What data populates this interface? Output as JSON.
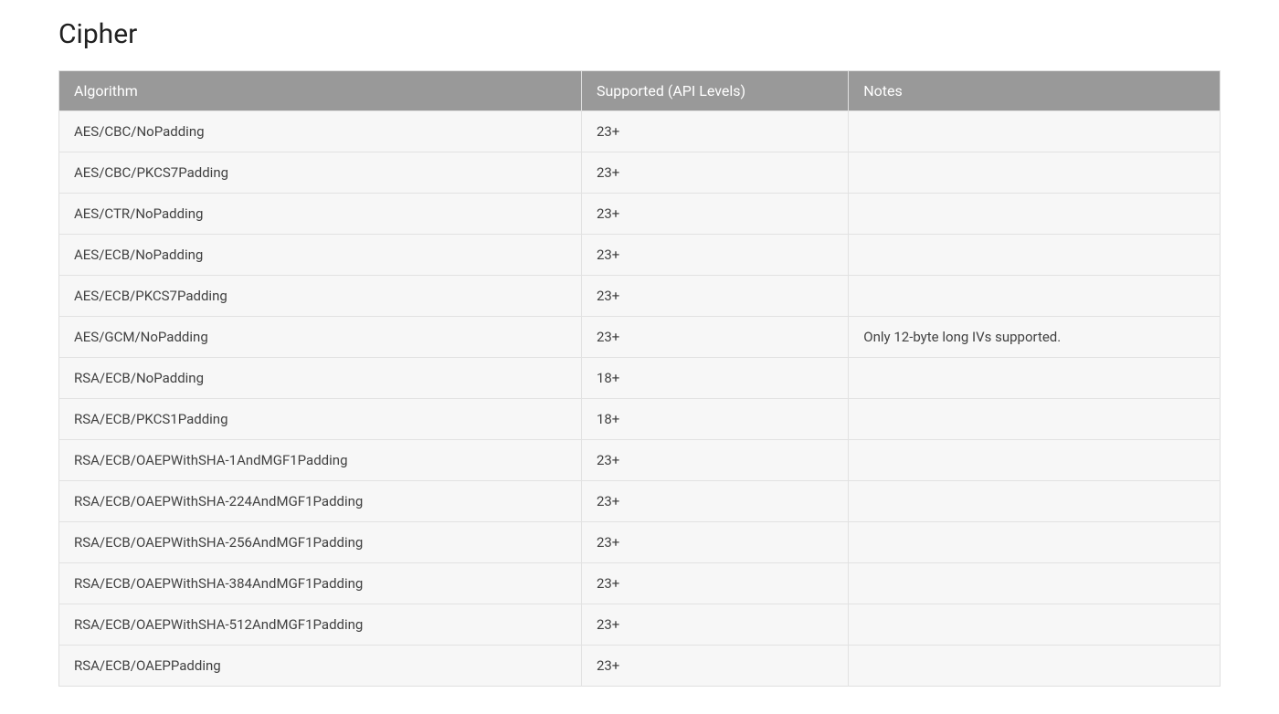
{
  "section": {
    "title": "Cipher"
  },
  "table": {
    "headers": {
      "algorithm": "Algorithm",
      "supported": "Supported (API Levels)",
      "notes": "Notes"
    },
    "rows": [
      {
        "algorithm": "AES/CBC/NoPadding",
        "supported": "23+",
        "notes": ""
      },
      {
        "algorithm": "AES/CBC/PKCS7Padding",
        "supported": "23+",
        "notes": ""
      },
      {
        "algorithm": "AES/CTR/NoPadding",
        "supported": "23+",
        "notes": ""
      },
      {
        "algorithm": "AES/ECB/NoPadding",
        "supported": "23+",
        "notes": ""
      },
      {
        "algorithm": "AES/ECB/PKCS7Padding",
        "supported": "23+",
        "notes": ""
      },
      {
        "algorithm": "AES/GCM/NoPadding",
        "supported": "23+",
        "notes": "Only 12-byte long IVs supported."
      },
      {
        "algorithm": "RSA/ECB/NoPadding",
        "supported": "18+",
        "notes": ""
      },
      {
        "algorithm": "RSA/ECB/PKCS1Padding",
        "supported": "18+",
        "notes": ""
      },
      {
        "algorithm": "RSA/ECB/OAEPWithSHA-1AndMGF1Padding",
        "supported": "23+",
        "notes": ""
      },
      {
        "algorithm": "RSA/ECB/OAEPWithSHA-224AndMGF1Padding",
        "supported": "23+",
        "notes": ""
      },
      {
        "algorithm": "RSA/ECB/OAEPWithSHA-256AndMGF1Padding",
        "supported": "23+",
        "notes": ""
      },
      {
        "algorithm": "RSA/ECB/OAEPWithSHA-384AndMGF1Padding",
        "supported": "23+",
        "notes": ""
      },
      {
        "algorithm": "RSA/ECB/OAEPWithSHA-512AndMGF1Padding",
        "supported": "23+",
        "notes": ""
      },
      {
        "algorithm": "RSA/ECB/OAEPPadding",
        "supported": "23+",
        "notes": ""
      }
    ]
  }
}
